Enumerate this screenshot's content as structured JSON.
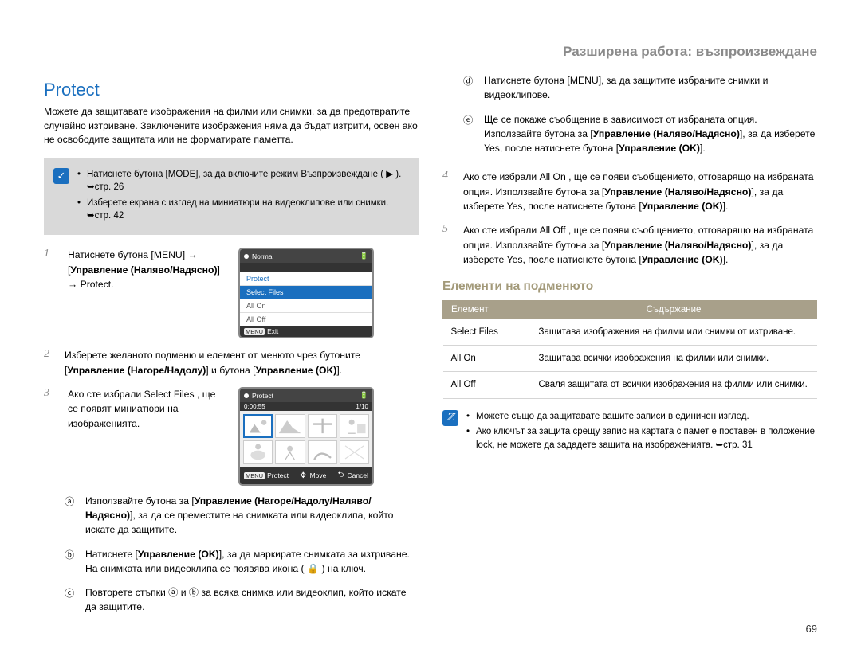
{
  "header": {
    "section": "Разширена работа: възпроизвеждане"
  },
  "title": "Protect",
  "intro": "Можете да защитавате изображения на филми или снимки, за да предотвратите случайно изтриване. Заключените изображения няма да бъдат изтрити, освен ако не освободите защитата или не форматирате паметта.",
  "note1": {
    "a": "Натиснете бутона [MODE], за да включите режим Възпроизвеждане ( ▶ ). ➥стр. 26",
    "b": "Изберете екрана с изглед на миниатюри на видеоклипове или снимки. ➥стр. 42"
  },
  "step1": {
    "pre": "Натиснете бутона [MENU] → [",
    "bold": "Управление (Наляво/Надясно)",
    "post": "] → Protect."
  },
  "screen1": {
    "header": "Normal",
    "item1": "Protect",
    "item2": "Select Files",
    "item3": "All On",
    "item4": "All Off",
    "footer_key": "MENU",
    "footer_text": "Exit"
  },
  "step2": {
    "text_pre": "Изберете желаното подменю и елемент от менюто чрез бутоните [",
    "bold1": "Управление (Нагоре/Надолу)",
    "mid": "] и бутона [",
    "bold2": "Управление (OK)",
    "post": "]."
  },
  "step3": {
    "text": "Ако сте избрали Select Files , ще се появят миниатюри на изображенията."
  },
  "screen2": {
    "header": "Protect",
    "time": "0:00:55",
    "counter": "1/10",
    "f_key1": "MENU",
    "f_txt1": "Protect",
    "f_txt2": "Move",
    "f_txt3": "Cancel"
  },
  "sub_a_pre": "Използвайте бутона за [",
  "sub_a_bold": "Управление (Нагоре/Надолу/Наляво/Надясно)",
  "sub_a_post": "], за да се преместите на снимката или видеоклипа, който искате да защитите.",
  "sub_b_pre": "Натиснете [",
  "sub_b_bold": "Управление (OK)",
  "sub_b_post": "], за да маркирате снимката за изтриване. На снимката или видеоклипа се появява икона ( 🔒 ) на ключ.",
  "sub_c": "Повторете стъпки ⓐ и ⓑ за всяка снимка или видеоклип, който искате да защитите.",
  "sub_d_pre": "Натиснете бутона [MENU], за да защитите избраните снимки и видеоклипове.",
  "sub_e_pre": "Ще се покаже съобщение в зависимост от избраната опция. Използвайте бутона за [",
  "sub_e_bold1": "Управление (Наляво/Надясно)",
  "sub_e_mid": "], за да изберете Yes, после натиснете бутона [",
  "sub_e_bold2": "Управление (OK)",
  "sub_e_post": "].",
  "step4_pre": "Ако сте избрали All On , ще се появи съобщението, отговарящо на избраната опция. Използвайте бутона за [",
  "step4_bold1": "Управление (Наляво/Надясно)",
  "step4_mid": "], за да изберете Yes, после натиснете бутона [",
  "step4_bold2": "Управление (OK)",
  "step4_post": "].",
  "step5_pre": "Ако сте избрали All Off , ще се появи съобщението, отговарящо на избраната опция. Използвайте бутона за [",
  "step5_bold1": "Управление (Наляво/Надясно)",
  "step5_mid": "], за да изберете Yes, после натиснете бутона [",
  "step5_bold2": "Управление (OK)",
  "step5_post": "].",
  "submenu_heading": "Елементи на подменюто",
  "table": {
    "h1": "Елемент",
    "h2": "Съдържание",
    "r1c1": "Select Files",
    "r1c2": "Защитава изображения на филми или снимки от изтриване.",
    "r2c1": "All On",
    "r2c2": "Защитава всички изображения на филми или снимки.",
    "r3c1": "All Off",
    "r3c2": "Сваля защитата от всички изображения на филми или снимки."
  },
  "info": {
    "a": "Можете също да защитавате вашите записи в единичен изглед.",
    "b": "Ако ключът за защита срещу запис на картата с памет е поставен в положение lock, не можете да зададете защита на изображенията. ➥стр. 31"
  },
  "page_num": "69"
}
